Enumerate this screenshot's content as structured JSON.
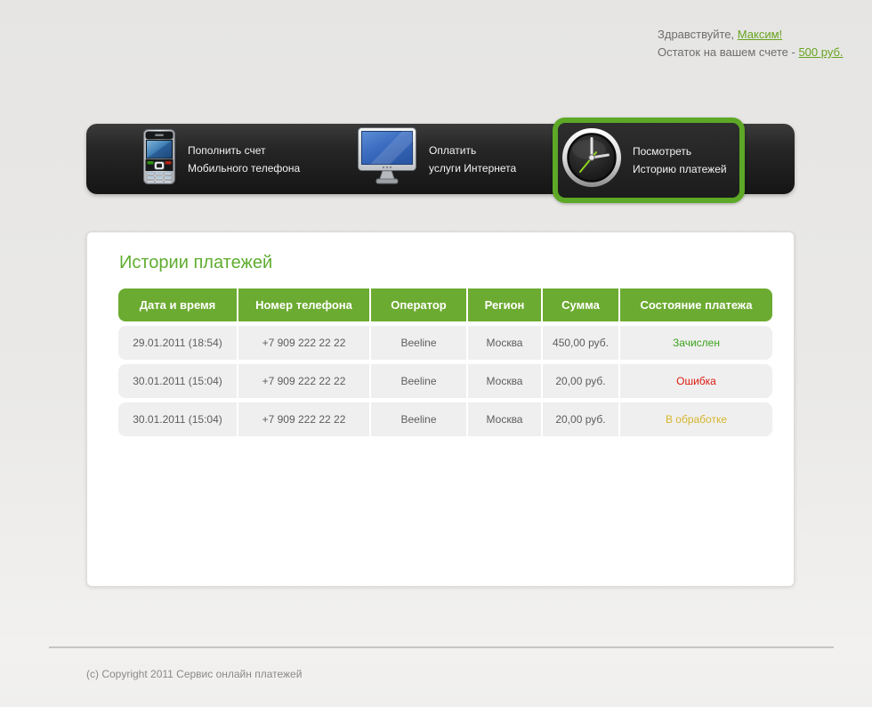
{
  "header": {
    "greeting_prefix": "Здравствуйте,",
    "greeting_name": "Максим!",
    "balance_prefix": "Остаток на вашем счете -",
    "balance_amount": "500 руб."
  },
  "nav": {
    "items": [
      {
        "line1": "Пополнить счет",
        "line2": "Мобильного телефона",
        "icon": "mobile-phone-icon",
        "active": false
      },
      {
        "line1": "Оплатить",
        "line2": "услуги Интернета",
        "icon": "monitor-icon",
        "active": false
      },
      {
        "line1": "Посмотреть",
        "line2": "Историю платежей",
        "icon": "clock-icon",
        "active": true
      }
    ]
  },
  "main": {
    "title": "Истории платежей",
    "table": {
      "columns": [
        "Дата и время",
        "Номер телефона",
        "Оператор",
        "Регион",
        "Сумма",
        "Состояние платежа"
      ],
      "rows": [
        {
          "datetime": "29.01.2011 (18:54)",
          "phone": "+7 909 222 22 22",
          "operator": "Beeline",
          "region": "Москва",
          "amount": "450,00 руб.",
          "status": "Зачислен",
          "status_type": "success"
        },
        {
          "datetime": "30.01.2011 (15:04)",
          "phone": "+7 909 222 22 22",
          "operator": "Beeline",
          "region": "Москва",
          "amount": "20,00 руб.",
          "status": "Ошибка",
          "status_type": "error"
        },
        {
          "datetime": "30.01.2011 (15:04)",
          "phone": "+7 909 222 22 22",
          "operator": "Beeline",
          "region": "Москва",
          "amount": "20,00 руб.",
          "status": "В обработке",
          "status_type": "processing"
        }
      ]
    }
  },
  "footer": {
    "copyright": "(c) Copyright 2011 Сервис онлайн платежей"
  },
  "colors": {
    "accent_green": "#5da826",
    "table_header_green": "#6cab31",
    "title_green": "#5fad2f",
    "link_green": "#67a41f",
    "status_success": "#3aa41e",
    "status_error": "#da1a10",
    "status_processing": "#d4b52e"
  }
}
